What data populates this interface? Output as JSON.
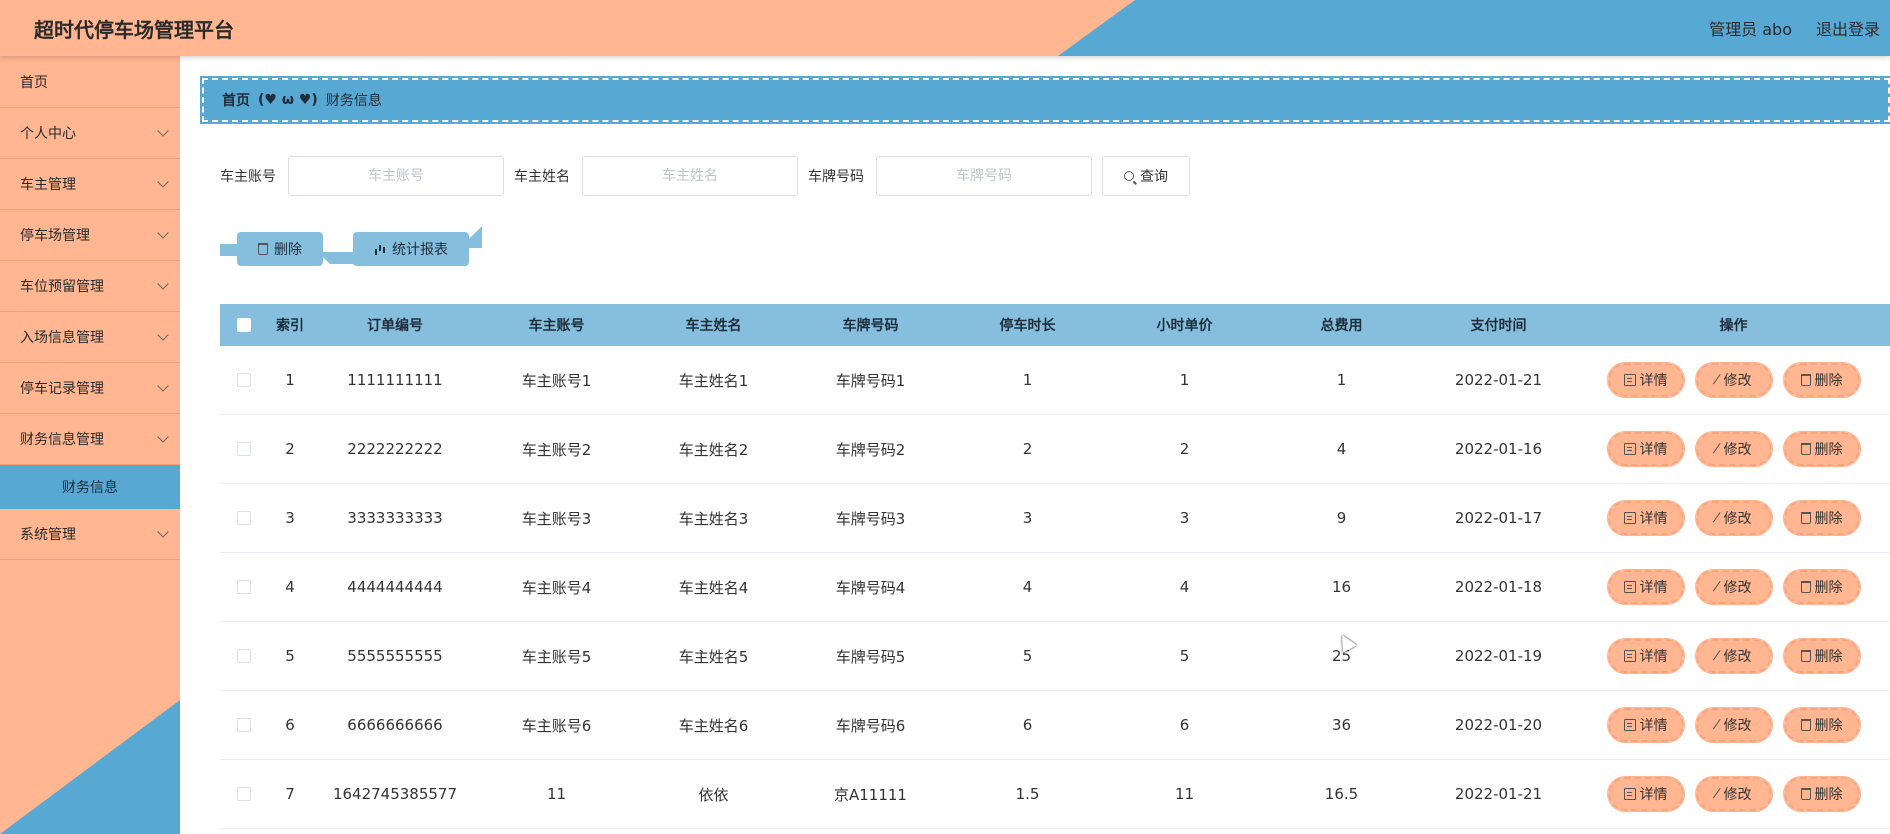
{
  "header": {
    "title": "超时代停车场管理平台",
    "user": "管理员 abo",
    "logout": "退出登录"
  },
  "sidebar": {
    "items": [
      {
        "label": "首页",
        "has_chevron": false
      },
      {
        "label": "个人中心",
        "has_chevron": true
      },
      {
        "label": "车主管理",
        "has_chevron": true
      },
      {
        "label": "停车场管理",
        "has_chevron": true
      },
      {
        "label": "车位预留管理",
        "has_chevron": true
      },
      {
        "label": "入场信息管理",
        "has_chevron": true
      },
      {
        "label": "停车记录管理",
        "has_chevron": true
      },
      {
        "label": "财务信息管理",
        "has_chevron": true
      }
    ],
    "active_sub": "财务信息",
    "last_item": "系统管理"
  },
  "breadcrumb": {
    "home": "首页",
    "separator": "(♥ ω ♥)",
    "current": "财务信息"
  },
  "search": {
    "account_label": "车主账号",
    "account_placeholder": "车主账号",
    "name_label": "车主姓名",
    "name_placeholder": "车主姓名",
    "plate_label": "车牌号码",
    "plate_placeholder": "车牌号码",
    "query_label": "查询"
  },
  "actions": {
    "delete_label": "删除",
    "report_label": "统计报表"
  },
  "table": {
    "headers": [
      "索引",
      "订单编号",
      "车主账号",
      "车主姓名",
      "车牌号码",
      "停车时长",
      "小时单价",
      "总费用",
      "支付时间",
      "操作"
    ],
    "op_labels": {
      "detail": "详情",
      "edit": "修改",
      "delete": "删除"
    },
    "rows": [
      [
        "1",
        "1111111111",
        "车主账号1",
        "车主姓名1",
        "车牌号码1",
        "1",
        "1",
        "1",
        "2022-01-21"
      ],
      [
        "2",
        "2222222222",
        "车主账号2",
        "车主姓名2",
        "车牌号码2",
        "2",
        "2",
        "4",
        "2022-01-16"
      ],
      [
        "3",
        "3333333333",
        "车主账号3",
        "车主姓名3",
        "车牌号码3",
        "3",
        "3",
        "9",
        "2022-01-17"
      ],
      [
        "4",
        "4444444444",
        "车主账号4",
        "车主姓名4",
        "车牌号码4",
        "4",
        "4",
        "16",
        "2022-01-18"
      ],
      [
        "5",
        "5555555555",
        "车主账号5",
        "车主姓名5",
        "车牌号码5",
        "5",
        "5",
        "25",
        "2022-01-19"
      ],
      [
        "6",
        "6666666666",
        "车主账号6",
        "车主姓名6",
        "车牌号码6",
        "6",
        "6",
        "36",
        "2022-01-20"
      ],
      [
        "7",
        "1642745385577",
        "11",
        "依依",
        "京A11111",
        "1.5",
        "11",
        "16.5",
        "2022-01-21"
      ]
    ]
  },
  "colors": {
    "peach": "#ffb691",
    "blue": "#58a8d4",
    "light_blue": "#86bfde"
  }
}
